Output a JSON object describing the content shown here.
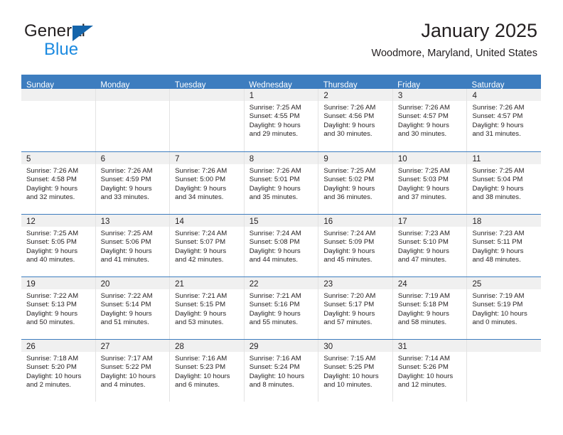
{
  "brand": {
    "name_top": "General",
    "name_bottom": "Blue",
    "accent_color": "#1464aa",
    "accent_color_light": "#1b8ae0"
  },
  "header": {
    "title": "January 2025",
    "location": "Woodmore, Maryland, United States"
  },
  "theme": {
    "header_row_bg": "#3d7dbf",
    "day_band_bg": "#f0f0f0",
    "cell_border": "#e3e3e3",
    "text": "#231f20"
  },
  "weekdays": [
    "Sunday",
    "Monday",
    "Tuesday",
    "Wednesday",
    "Thursday",
    "Friday",
    "Saturday"
  ],
  "weeks": [
    [
      {
        "day": "",
        "sunrise": "",
        "sunset": "",
        "daylight_line1": "",
        "daylight_line2": ""
      },
      {
        "day": "",
        "sunrise": "",
        "sunset": "",
        "daylight_line1": "",
        "daylight_line2": ""
      },
      {
        "day": "",
        "sunrise": "",
        "sunset": "",
        "daylight_line1": "",
        "daylight_line2": ""
      },
      {
        "day": "1",
        "sunrise": "Sunrise: 7:25 AM",
        "sunset": "Sunset: 4:55 PM",
        "daylight_line1": "Daylight: 9 hours",
        "daylight_line2": "and 29 minutes."
      },
      {
        "day": "2",
        "sunrise": "Sunrise: 7:26 AM",
        "sunset": "Sunset: 4:56 PM",
        "daylight_line1": "Daylight: 9 hours",
        "daylight_line2": "and 30 minutes."
      },
      {
        "day": "3",
        "sunrise": "Sunrise: 7:26 AM",
        "sunset": "Sunset: 4:57 PM",
        "daylight_line1": "Daylight: 9 hours",
        "daylight_line2": "and 30 minutes."
      },
      {
        "day": "4",
        "sunrise": "Sunrise: 7:26 AM",
        "sunset": "Sunset: 4:57 PM",
        "daylight_line1": "Daylight: 9 hours",
        "daylight_line2": "and 31 minutes."
      }
    ],
    [
      {
        "day": "5",
        "sunrise": "Sunrise: 7:26 AM",
        "sunset": "Sunset: 4:58 PM",
        "daylight_line1": "Daylight: 9 hours",
        "daylight_line2": "and 32 minutes."
      },
      {
        "day": "6",
        "sunrise": "Sunrise: 7:26 AM",
        "sunset": "Sunset: 4:59 PM",
        "daylight_line1": "Daylight: 9 hours",
        "daylight_line2": "and 33 minutes."
      },
      {
        "day": "7",
        "sunrise": "Sunrise: 7:26 AM",
        "sunset": "Sunset: 5:00 PM",
        "daylight_line1": "Daylight: 9 hours",
        "daylight_line2": "and 34 minutes."
      },
      {
        "day": "8",
        "sunrise": "Sunrise: 7:26 AM",
        "sunset": "Sunset: 5:01 PM",
        "daylight_line1": "Daylight: 9 hours",
        "daylight_line2": "and 35 minutes."
      },
      {
        "day": "9",
        "sunrise": "Sunrise: 7:25 AM",
        "sunset": "Sunset: 5:02 PM",
        "daylight_line1": "Daylight: 9 hours",
        "daylight_line2": "and 36 minutes."
      },
      {
        "day": "10",
        "sunrise": "Sunrise: 7:25 AM",
        "sunset": "Sunset: 5:03 PM",
        "daylight_line1": "Daylight: 9 hours",
        "daylight_line2": "and 37 minutes."
      },
      {
        "day": "11",
        "sunrise": "Sunrise: 7:25 AM",
        "sunset": "Sunset: 5:04 PM",
        "daylight_line1": "Daylight: 9 hours",
        "daylight_line2": "and 38 minutes."
      }
    ],
    [
      {
        "day": "12",
        "sunrise": "Sunrise: 7:25 AM",
        "sunset": "Sunset: 5:05 PM",
        "daylight_line1": "Daylight: 9 hours",
        "daylight_line2": "and 40 minutes."
      },
      {
        "day": "13",
        "sunrise": "Sunrise: 7:25 AM",
        "sunset": "Sunset: 5:06 PM",
        "daylight_line1": "Daylight: 9 hours",
        "daylight_line2": "and 41 minutes."
      },
      {
        "day": "14",
        "sunrise": "Sunrise: 7:24 AM",
        "sunset": "Sunset: 5:07 PM",
        "daylight_line1": "Daylight: 9 hours",
        "daylight_line2": "and 42 minutes."
      },
      {
        "day": "15",
        "sunrise": "Sunrise: 7:24 AM",
        "sunset": "Sunset: 5:08 PM",
        "daylight_line1": "Daylight: 9 hours",
        "daylight_line2": "and 44 minutes."
      },
      {
        "day": "16",
        "sunrise": "Sunrise: 7:24 AM",
        "sunset": "Sunset: 5:09 PM",
        "daylight_line1": "Daylight: 9 hours",
        "daylight_line2": "and 45 minutes."
      },
      {
        "day": "17",
        "sunrise": "Sunrise: 7:23 AM",
        "sunset": "Sunset: 5:10 PM",
        "daylight_line1": "Daylight: 9 hours",
        "daylight_line2": "and 47 minutes."
      },
      {
        "day": "18",
        "sunrise": "Sunrise: 7:23 AM",
        "sunset": "Sunset: 5:11 PM",
        "daylight_line1": "Daylight: 9 hours",
        "daylight_line2": "and 48 minutes."
      }
    ],
    [
      {
        "day": "19",
        "sunrise": "Sunrise: 7:22 AM",
        "sunset": "Sunset: 5:13 PM",
        "daylight_line1": "Daylight: 9 hours",
        "daylight_line2": "and 50 minutes."
      },
      {
        "day": "20",
        "sunrise": "Sunrise: 7:22 AM",
        "sunset": "Sunset: 5:14 PM",
        "daylight_line1": "Daylight: 9 hours",
        "daylight_line2": "and 51 minutes."
      },
      {
        "day": "21",
        "sunrise": "Sunrise: 7:21 AM",
        "sunset": "Sunset: 5:15 PM",
        "daylight_line1": "Daylight: 9 hours",
        "daylight_line2": "and 53 minutes."
      },
      {
        "day": "22",
        "sunrise": "Sunrise: 7:21 AM",
        "sunset": "Sunset: 5:16 PM",
        "daylight_line1": "Daylight: 9 hours",
        "daylight_line2": "and 55 minutes."
      },
      {
        "day": "23",
        "sunrise": "Sunrise: 7:20 AM",
        "sunset": "Sunset: 5:17 PM",
        "daylight_line1": "Daylight: 9 hours",
        "daylight_line2": "and 57 minutes."
      },
      {
        "day": "24",
        "sunrise": "Sunrise: 7:19 AM",
        "sunset": "Sunset: 5:18 PM",
        "daylight_line1": "Daylight: 9 hours",
        "daylight_line2": "and 58 minutes."
      },
      {
        "day": "25",
        "sunrise": "Sunrise: 7:19 AM",
        "sunset": "Sunset: 5:19 PM",
        "daylight_line1": "Daylight: 10 hours",
        "daylight_line2": "and 0 minutes."
      }
    ],
    [
      {
        "day": "26",
        "sunrise": "Sunrise: 7:18 AM",
        "sunset": "Sunset: 5:20 PM",
        "daylight_line1": "Daylight: 10 hours",
        "daylight_line2": "and 2 minutes."
      },
      {
        "day": "27",
        "sunrise": "Sunrise: 7:17 AM",
        "sunset": "Sunset: 5:22 PM",
        "daylight_line1": "Daylight: 10 hours",
        "daylight_line2": "and 4 minutes."
      },
      {
        "day": "28",
        "sunrise": "Sunrise: 7:16 AM",
        "sunset": "Sunset: 5:23 PM",
        "daylight_line1": "Daylight: 10 hours",
        "daylight_line2": "and 6 minutes."
      },
      {
        "day": "29",
        "sunrise": "Sunrise: 7:16 AM",
        "sunset": "Sunset: 5:24 PM",
        "daylight_line1": "Daylight: 10 hours",
        "daylight_line2": "and 8 minutes."
      },
      {
        "day": "30",
        "sunrise": "Sunrise: 7:15 AM",
        "sunset": "Sunset: 5:25 PM",
        "daylight_line1": "Daylight: 10 hours",
        "daylight_line2": "and 10 minutes."
      },
      {
        "day": "31",
        "sunrise": "Sunrise: 7:14 AM",
        "sunset": "Sunset: 5:26 PM",
        "daylight_line1": "Daylight: 10 hours",
        "daylight_line2": "and 12 minutes."
      },
      {
        "day": "",
        "sunrise": "",
        "sunset": "",
        "daylight_line1": "",
        "daylight_line2": ""
      }
    ]
  ]
}
